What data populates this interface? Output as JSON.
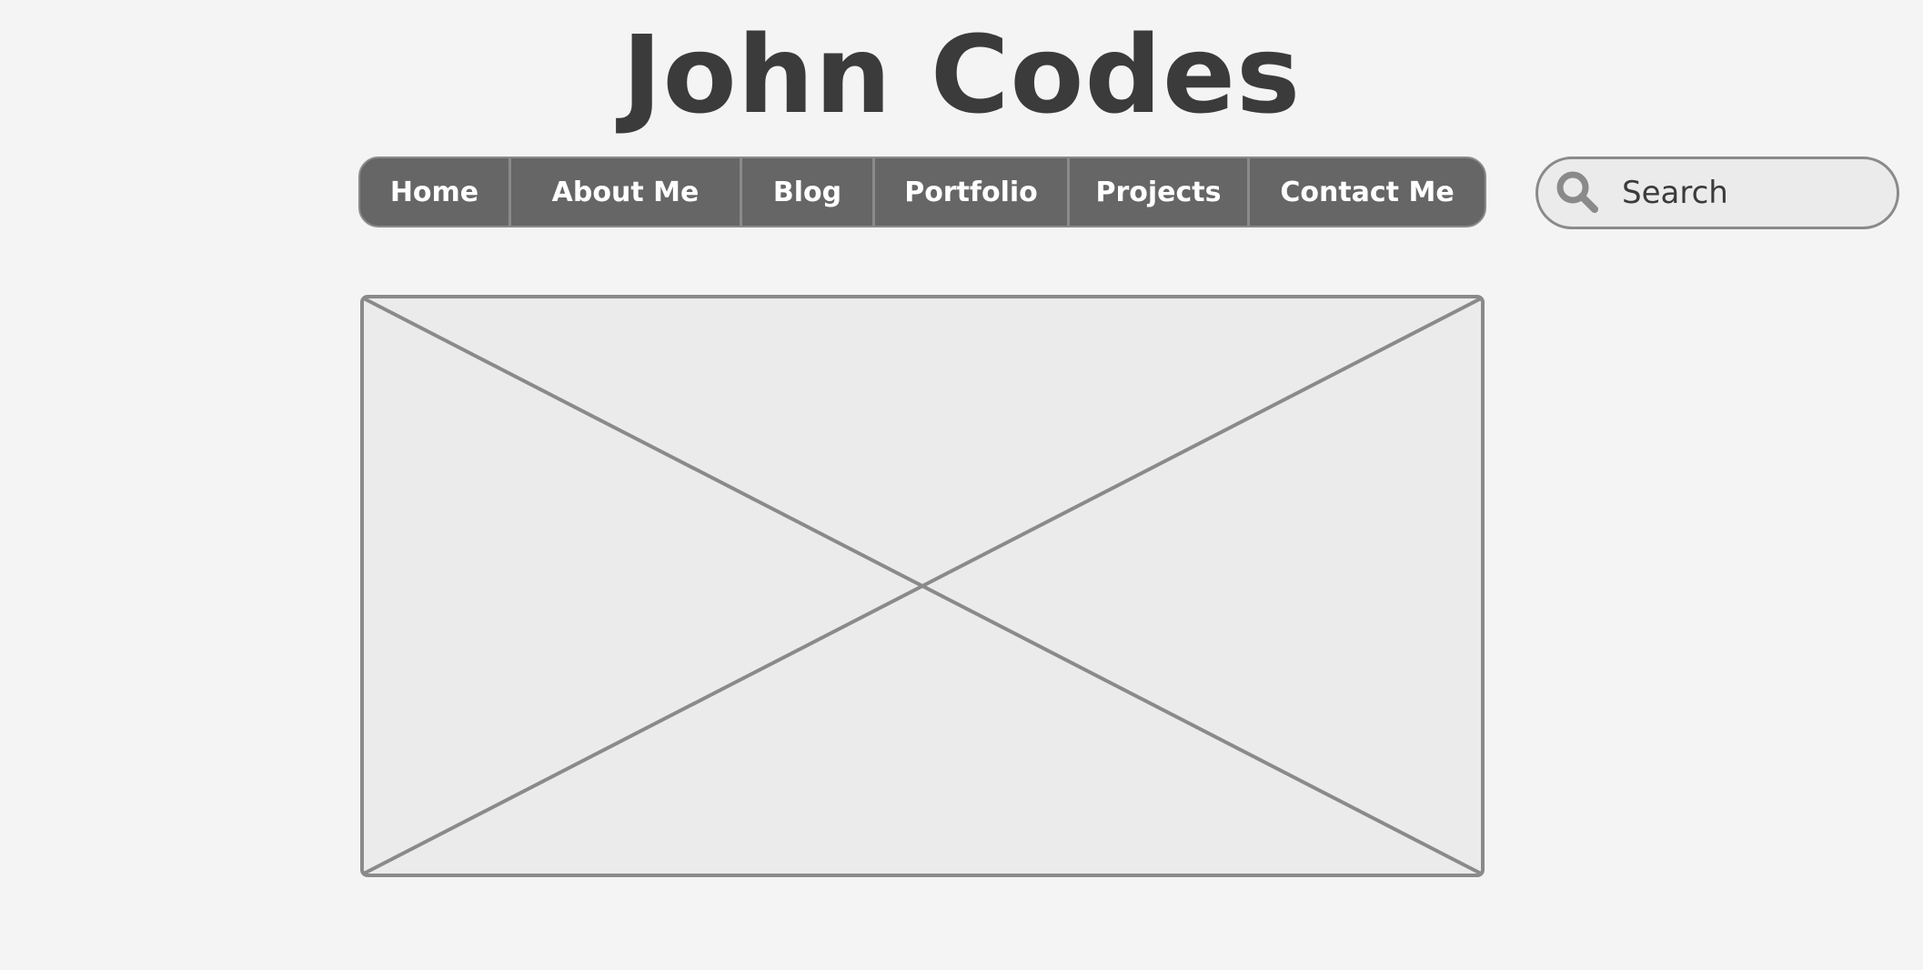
{
  "site": {
    "title": "John Codes"
  },
  "nav": {
    "items": [
      {
        "label": "Home"
      },
      {
        "label": "About Me"
      },
      {
        "label": "Blog"
      },
      {
        "label": "Portfolio"
      },
      {
        "label": "Projects"
      },
      {
        "label": "Contact Me"
      }
    ]
  },
  "search": {
    "placeholder": "Search",
    "icon": "search-icon"
  },
  "main": {
    "image": "image-placeholder"
  },
  "colors": {
    "background": "#f4f4f4",
    "title": "#3b3b3b",
    "nav_bg": "#666666",
    "nav_text": "#ffffff",
    "border": "#8a8a8a",
    "placeholder_fill": "#ebebeb"
  }
}
